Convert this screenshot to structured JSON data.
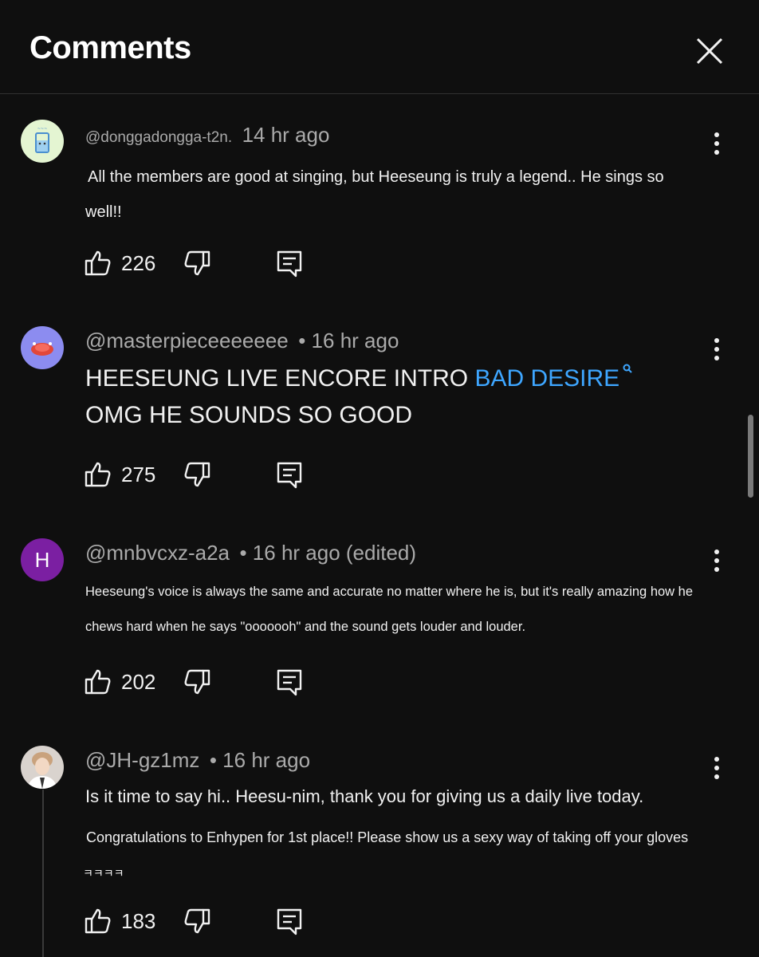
{
  "header": {
    "title": "Comments"
  },
  "comments": [
    {
      "handle": "@donggadongga-t2n.",
      "time": "14 hr ago",
      "text": "All the members are good at singing, but Heeseung is truly a legend.. He sings so well!!",
      "likes": "226"
    },
    {
      "handle": "@masterpieceeeeeee",
      "time": "• 16 hr ago",
      "text_before": "HEESEUNG LIVE ENCORE INTRO ",
      "link": "BAD DESIRE",
      "text_after": " OMG HE SOUNDS SO GOOD",
      "likes": "275"
    },
    {
      "handle": "@mnbvcxz-a2a",
      "time": "• 16 hr ago (edited)",
      "avatar_letter": "H",
      "text": "Heeseung's voice is always the same and accurate no matter where he is, but it's really amazing how he chews hard when he says \"ooooooh\" and the sound gets louder and louder.",
      "likes": "202"
    },
    {
      "handle": "@JH-gz1mz",
      "time": "• 16 hr ago",
      "text_line1": "Is it time to say hi.. Heesu-nim, thank you for giving us a daily live today.",
      "text_line2": "Congratulations to Enhypen for 1st place!! Please show us a sexy way of taking off your gloves",
      "text_suffix": "ㅋㅋㅋㅋ",
      "likes": "183"
    }
  ],
  "colors": {
    "background": "#0f0f0f",
    "link": "#3ea6ff",
    "avatar_letter_bg": "#7b1fa2"
  }
}
